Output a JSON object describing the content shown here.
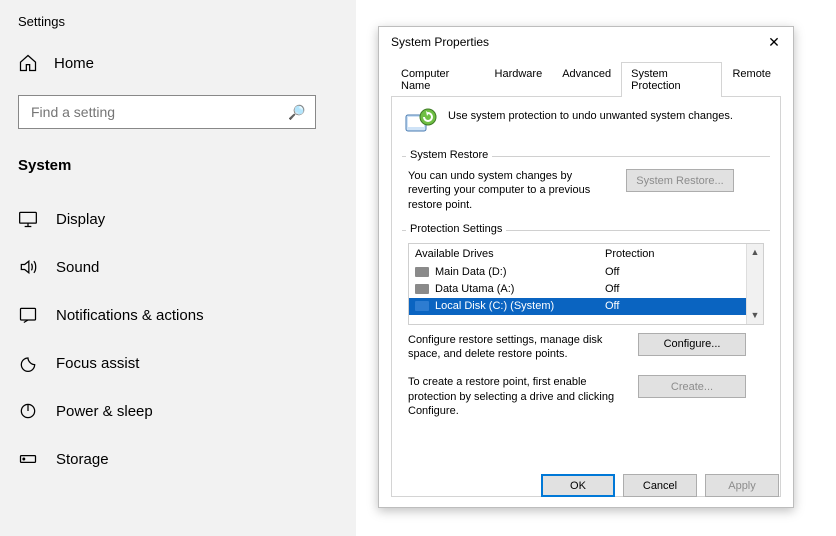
{
  "settings": {
    "title": "Settings",
    "home_label": "Home",
    "search_placeholder": "Find a setting",
    "section_header": "System",
    "nav": [
      {
        "label": "Display"
      },
      {
        "label": "Sound"
      },
      {
        "label": "Notifications & actions"
      },
      {
        "label": "Focus assist"
      },
      {
        "label": "Power & sleep"
      },
      {
        "label": "Storage"
      }
    ]
  },
  "dialog": {
    "title": "System Properties",
    "tabs": [
      {
        "label": "Computer Name",
        "active": false
      },
      {
        "label": "Hardware",
        "active": false
      },
      {
        "label": "Advanced",
        "active": false
      },
      {
        "label": "System Protection",
        "active": true
      },
      {
        "label": "Remote",
        "active": false
      }
    ],
    "intro_text": "Use system protection to undo unwanted system changes.",
    "system_restore": {
      "legend": "System Restore",
      "text": "You can undo system changes by reverting your computer to a previous restore point.",
      "button": "System Restore..."
    },
    "protection": {
      "legend": "Protection Settings",
      "col_drive": "Available Drives",
      "col_protection": "Protection",
      "drives": [
        {
          "name": "Main Data (D:)",
          "protection": "Off",
          "selected": false,
          "system": false
        },
        {
          "name": "Data Utama (A:)",
          "protection": "Off",
          "selected": false,
          "system": false
        },
        {
          "name": "Local Disk (C:) (System)",
          "protection": "Off",
          "selected": true,
          "system": true
        }
      ],
      "configure_text": "Configure restore settings, manage disk space, and delete restore points.",
      "configure_button": "Configure...",
      "create_text": "To create a restore point, first enable protection by selecting a drive and clicking Configure.",
      "create_button": "Create..."
    },
    "footer": {
      "ok": "OK",
      "cancel": "Cancel",
      "apply": "Apply"
    }
  }
}
